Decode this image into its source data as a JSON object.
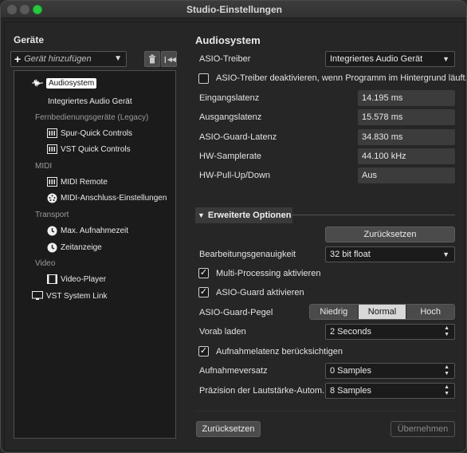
{
  "window": {
    "title": "Studio-Einstellungen"
  },
  "left": {
    "header": "Geräte",
    "add_device_placeholder": "Gerät hinzufügen",
    "tree": [
      {
        "label": "Audiosystem",
        "type": "item",
        "icon": "waveform-icon",
        "selected": true
      },
      {
        "label": "Integriertes Audio Gerät",
        "type": "subitem"
      },
      {
        "label": "Fernbedienungsgeräte (Legacy)",
        "type": "category"
      },
      {
        "label": "Spur-Quick Controls",
        "type": "item",
        "icon": "control-panel-icon"
      },
      {
        "label": "VST Quick Controls",
        "type": "item",
        "icon": "control-panel-icon"
      },
      {
        "label": "MIDI",
        "type": "category"
      },
      {
        "label": "MIDI Remote",
        "type": "item",
        "icon": "control-panel-icon"
      },
      {
        "label": "MIDI-Anschluss-Einstellungen",
        "type": "item",
        "icon": "midi-port-icon"
      },
      {
        "label": "Transport",
        "type": "category"
      },
      {
        "label": "Max. Aufnahmezeit",
        "type": "item",
        "icon": "clock-icon"
      },
      {
        "label": "Zeitanzeige",
        "type": "item",
        "icon": "clock-icon"
      },
      {
        "label": "Video",
        "type": "category"
      },
      {
        "label": "Video-Player",
        "type": "item",
        "icon": "film-icon"
      },
      {
        "label": "VST System Link",
        "type": "item",
        "icon": "monitor-icon"
      }
    ]
  },
  "main": {
    "header": "Audiosystem",
    "asio_driver_label": "ASIO-Treiber",
    "asio_driver_value": "Integriertes Audio Gerät",
    "deactivate_label": "ASIO-Treiber deaktivieren, wenn Programm im Hintergrund läuft.",
    "deactivate_checked": false,
    "latency": [
      {
        "label": "Eingangslatenz",
        "value": "14.195 ms"
      },
      {
        "label": "Ausgangslatenz",
        "value": "15.578 ms"
      },
      {
        "label": "ASIO-Guard-Latenz",
        "value": "34.830 ms"
      },
      {
        "label": "HW-Samplerate",
        "value": "44.100 kHz"
      },
      {
        "label": "HW-Pull-Up/Down",
        "value": "Aus"
      }
    ],
    "advanced_label": "Erweiterte Optionen",
    "reset_label": "Zurücksetzen",
    "precision_label": "Bearbeitungsgenauigkeit",
    "precision_value": "32 bit float",
    "multi_processing_label": "Multi-Processing aktivieren",
    "multi_processing_checked": true,
    "asio_guard_label": "ASIO-Guard aktivieren",
    "asio_guard_checked": true,
    "asio_guard_level_label": "ASIO-Guard-Pegel",
    "asio_guard_levels": [
      "Niedrig",
      "Normal",
      "Hoch"
    ],
    "asio_guard_level_selected": "Normal",
    "preload_label": "Vorab laden",
    "preload_value": "2 Seconds",
    "record_latency_label": "Aufnahmelatenz berücksichtigen",
    "record_latency_checked": true,
    "record_offset_label": "Aufnahmeversatz",
    "record_offset_value": "0 Samples",
    "volume_precision_label": "Präzision der Lautstärke-Autom.",
    "volume_precision_value": "8 Samples",
    "footer_reset_label": "Zurücksetzen",
    "apply_label": "Übernehmen"
  }
}
